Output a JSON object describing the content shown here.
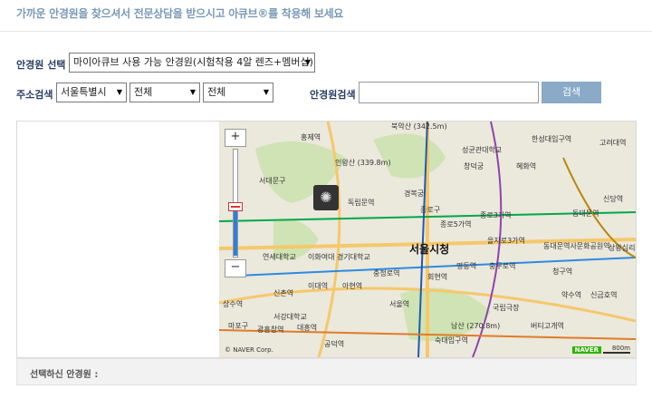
{
  "banner": {
    "text": "가까운 안경원을 찾으셔서 전문상담을 받으시고 아큐브®를 착용해 보세요"
  },
  "form": {
    "store_label": "안경원 선택",
    "store_select_value": "마이아큐브 사용 가능 안경원(시험착용 4알 렌즈+멤버십)",
    "address_label": "주소검색",
    "city_value": "서울특별시",
    "district_value": "전체",
    "dong_value": "전체",
    "store_search_label": "안경원검색",
    "store_search_value": "",
    "search_button": "검색"
  },
  "map": {
    "zoom_in": "+",
    "zoom_out": "−",
    "zoom_level": 0.45,
    "labels": [
      "북악산 (342.5m)",
      "홍제역",
      "한성대입구역",
      "고려대역",
      "인왕산 (339.8m)",
      "성균관대학교",
      "창덕궁",
      "혜화역",
      "독립문역",
      "경복궁",
      "종로구",
      "종로3가역",
      "동대문역",
      "종로5가역",
      "서울시청",
      "을지로3가역",
      "동대문역사문화공원역",
      "신당역",
      "서대문구",
      "연세대학교",
      "이화여대",
      "경기대학교",
      "충정로역",
      "명동역",
      "충무로역",
      "신촌역",
      "이대역",
      "아현역",
      "서울역",
      "회현역",
      "약수역",
      "국립극장",
      "신금호역",
      "남산 (270.8m)",
      "공덕역",
      "숙대입구역",
      "버티고개역",
      "청구역",
      "상왕십리역",
      "상수역",
      "광흥창역",
      "대흥역",
      "서강대학교",
      "마포구"
    ],
    "copyright": "© NAVER Corp.",
    "brand": "NAVER",
    "scale": "800m"
  },
  "footer": {
    "selected_label": "선택하신 안경원 :"
  }
}
